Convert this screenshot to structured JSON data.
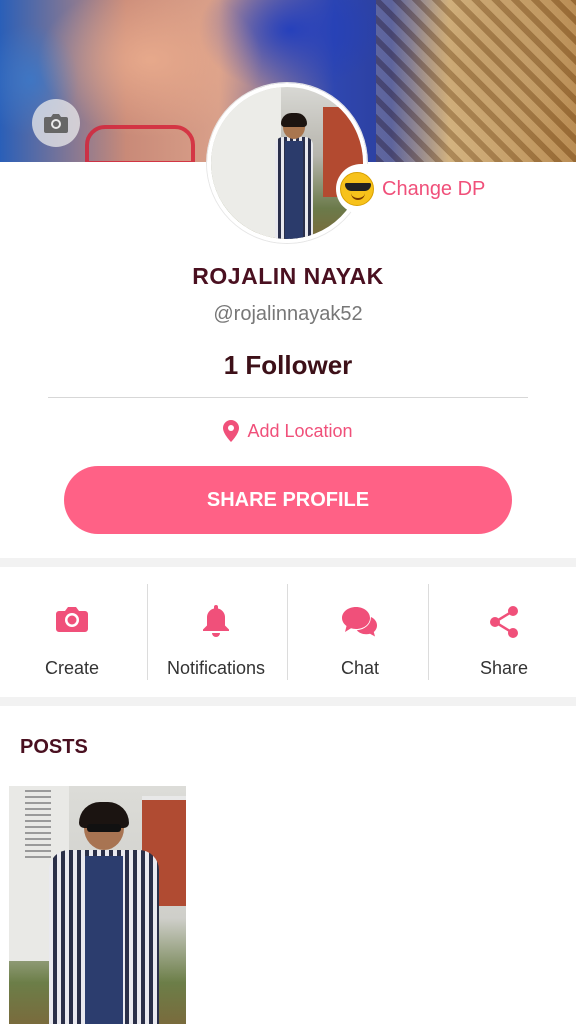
{
  "profile": {
    "change_dp_label": "Change DP",
    "name": "ROJALIN NAYAK",
    "handle": "@rojalinnayak52",
    "followers": "1 Follower",
    "location_label": "Add Location",
    "share_button_label": "SHARE PROFILE"
  },
  "actions": [
    {
      "label": "Create",
      "icon": "camera-icon"
    },
    {
      "label": "Notifications",
      "icon": "bell-icon"
    },
    {
      "label": "Chat",
      "icon": "chat-bubbles-icon"
    },
    {
      "label": "Share",
      "icon": "share-icon"
    }
  ],
  "posts": {
    "title": "POSTS"
  },
  "colors": {
    "accent": "#ff6186",
    "accent_text": "#f0507a",
    "name_text": "#4a1020"
  }
}
